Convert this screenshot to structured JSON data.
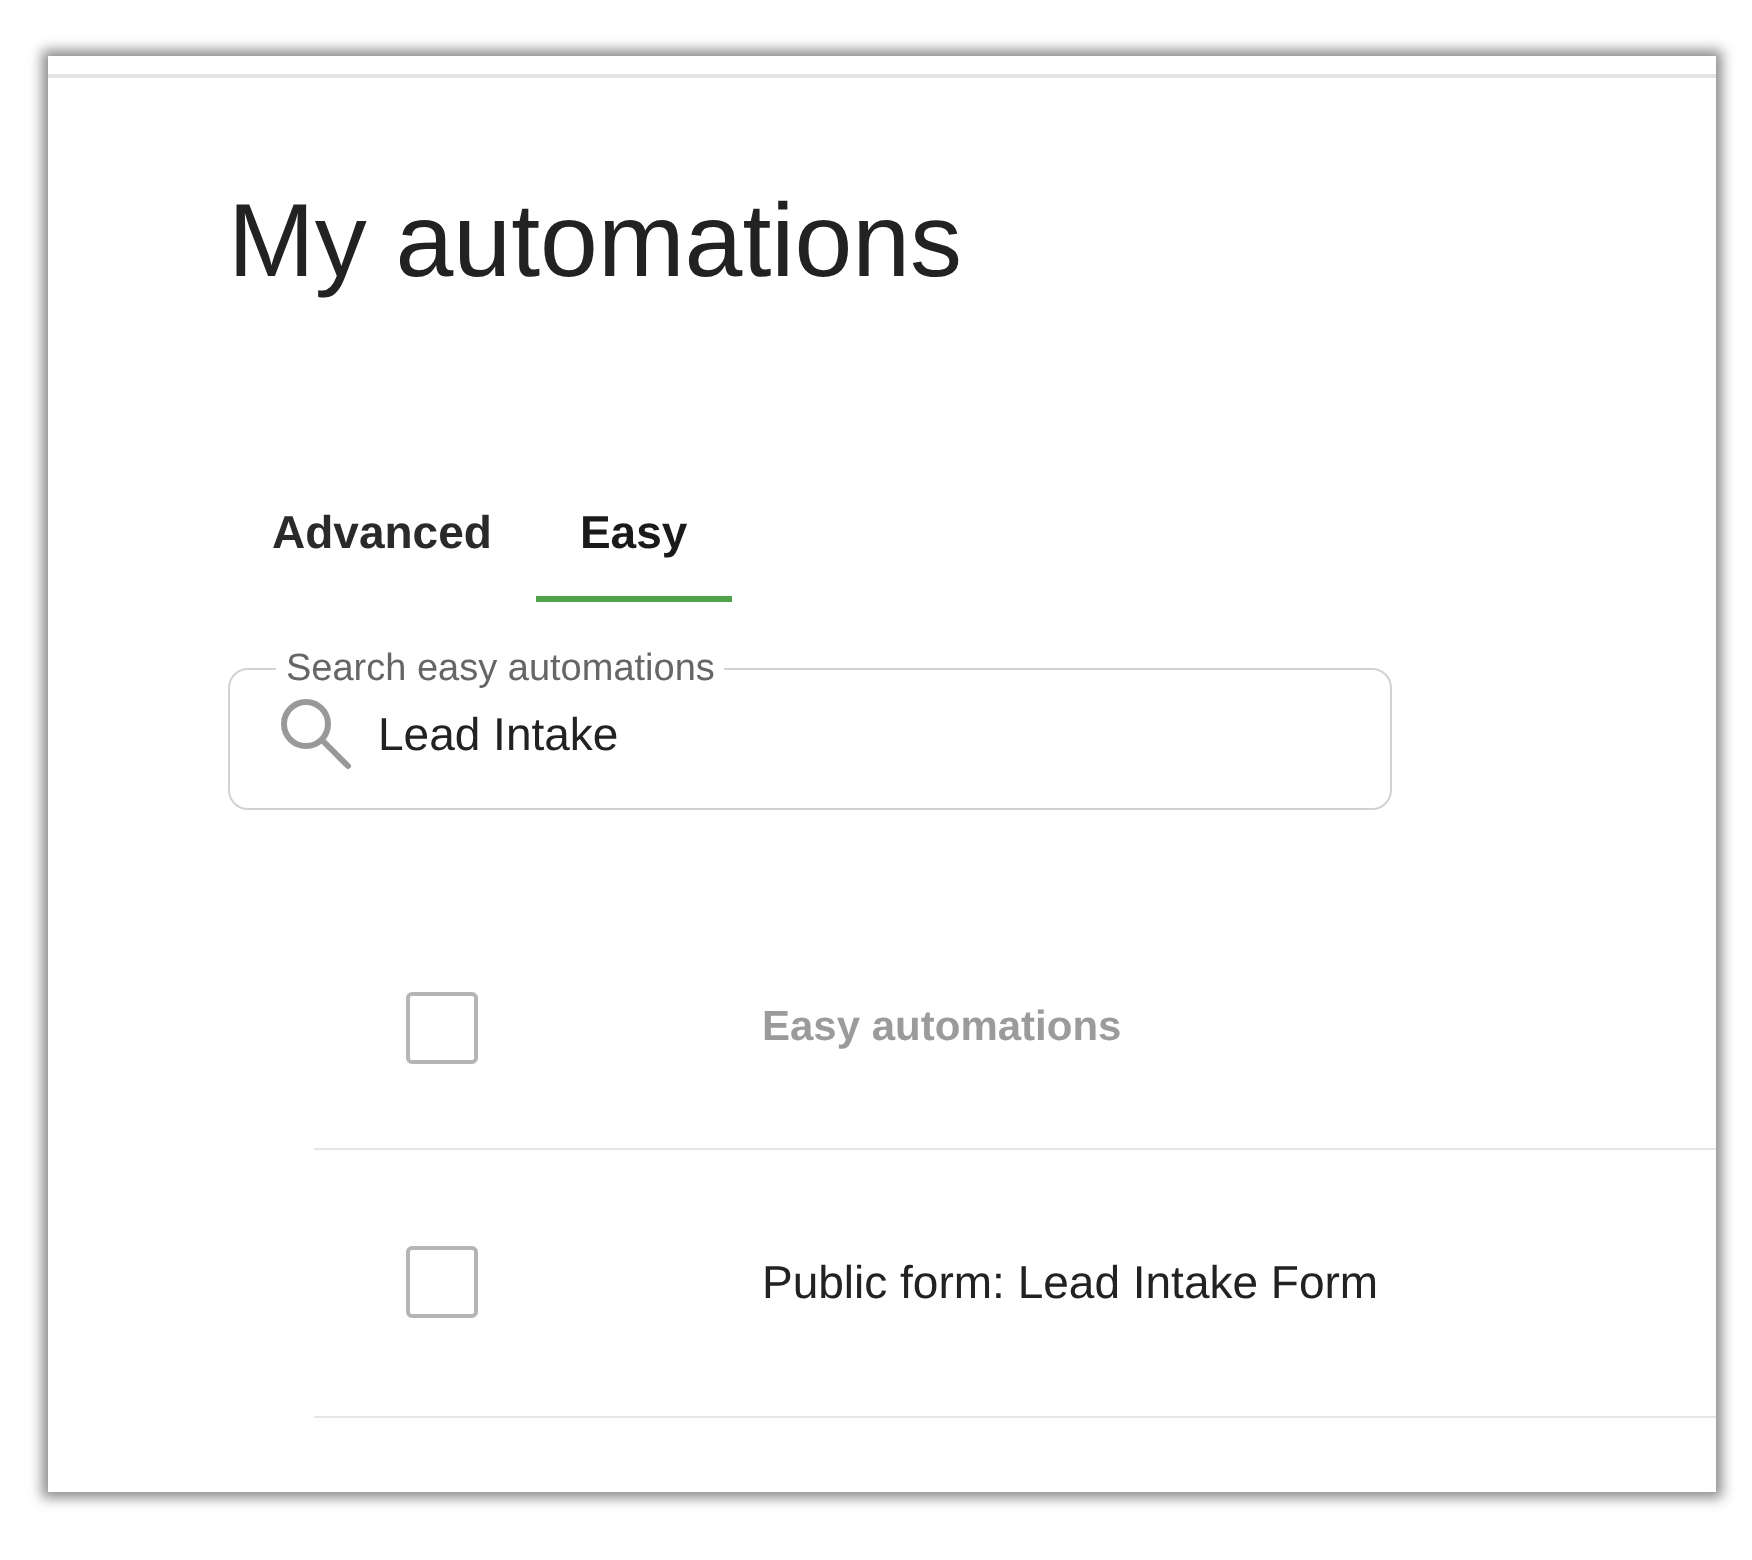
{
  "page": {
    "title": "My automations"
  },
  "tabs": [
    {
      "label": "Advanced",
      "selected": false
    },
    {
      "label": "Easy",
      "selected": true
    }
  ],
  "search": {
    "label": "Search easy automations",
    "value": "Lead Intake"
  },
  "table": {
    "header": {
      "label": "Easy automations",
      "checked": false
    },
    "rows": [
      {
        "name": "Public form: Lead Intake Form",
        "checked": false
      }
    ]
  }
}
